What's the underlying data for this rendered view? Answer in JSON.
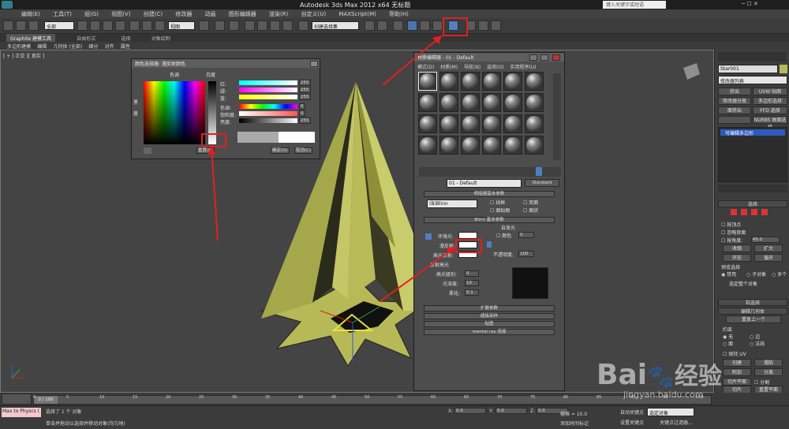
{
  "window": {
    "title": "Autodesk 3ds Max  2012 x64    无标题",
    "search_placeholder": "键入关键字或短语"
  },
  "menu": [
    "编辑(E)",
    "工具(T)",
    "组(G)",
    "视图(V)",
    "创建(C)",
    "修改器",
    "动画",
    "图形编辑器",
    "渲染(R)",
    "自定义(U)",
    "MAXScript(M)",
    "帮助(H)"
  ],
  "toolbar": {
    "filter": "全部",
    "view": "视图",
    "selection_set": "创建选择集"
  },
  "ribbon": {
    "tabs": [
      "Graphite 建模工具",
      "自由形式",
      "选择",
      "对象绘制"
    ],
    "subtabs": [
      "多边形建模",
      "编辑",
      "几何体 (全部)",
      "细分",
      "对齐",
      "属性"
    ]
  },
  "viewport": {
    "label": "[ + ] 正交 ][ 真实 ]"
  },
  "color_selector": {
    "title": "颜色选择器: 漫反射颜色",
    "hue_label": "色调",
    "whiteness_label": "白度",
    "blackness_label": "黑",
    "saturation_label": "度",
    "rows": [
      {
        "label": "红:",
        "value": "255"
      },
      {
        "label": "绿:",
        "value": "255"
      },
      {
        "label": "蓝:",
        "value": "255"
      },
      {
        "label": "色调:",
        "value": "0"
      },
      {
        "label": "饱和度:",
        "value": "0"
      },
      {
        "label": "亮度:",
        "value": "255"
      }
    ],
    "reset": "重置(R)",
    "ok": "确定(O)",
    "cancel": "取消(C)"
  },
  "material_editor": {
    "title": "材质编辑器 - 01 - Default",
    "menu": [
      "模式(D)",
      "材质(M)",
      "导航(N)",
      "选项(O)",
      "实用程序(U)"
    ],
    "material_name": "01 - Default",
    "material_type": "Standard",
    "shader_section": "明暗器基本参数",
    "shader": "(B)Blinn",
    "shader_options": [
      "线框",
      "双面",
      "面贴图",
      "面状"
    ],
    "blinn_section": "Blinn 基本参数",
    "self_illum": "自发光",
    "color_label": "颜色",
    "self_illum_value": "0",
    "ambient": "环境光:",
    "diffuse": "漫反射:",
    "specular": "高光反射:",
    "opacity_label": "不透明度:",
    "opacity": "100",
    "highlights": "反射高光",
    "spec_level_label": "高光级别:",
    "spec_level": "0",
    "gloss_label": "光泽度:",
    "gloss": "10",
    "soften_label": "柔化:",
    "soften": "0.1",
    "rollouts": [
      "扩展参数",
      "超级采样",
      "贴图",
      "mental ray 连接"
    ]
  },
  "command_panel": {
    "object_name": "Star001",
    "modifier_list": "修改器列表",
    "buttons": [
      "挤出",
      "UVW 贴图",
      "修改器分类",
      "多边形选择",
      "面挤出",
      "FFD 选择",
      "",
      "NURBS 曲面选择"
    ],
    "stack_item": "可编辑多边形",
    "selection": "选择",
    "by_vertex": "按顶点",
    "ignore_backface": "忽略背面",
    "angle_label": "按角度:",
    "angle": "45.0",
    "shrink": "收缩",
    "grow": "扩大",
    "ring": "环形",
    "loop": "循环",
    "preview": "预览选择",
    "disabled": "禁用",
    "subobject": "子对象",
    "multi": "多个",
    "select_all": "选定整个对象",
    "soft_selection": "软选择",
    "edit_geometry": "编辑几何体",
    "repeat": "重复上一个",
    "constraints": "约束",
    "none": "无",
    "edge": "边",
    "face": "面",
    "normal": "法线",
    "preserve_uv": "保持 UV",
    "create": "创建",
    "collapse": "塌陷",
    "attach": "附加",
    "detach": "分离",
    "slice_plane": "切片平面",
    "split": "分割",
    "slice": "切片",
    "reset_plane": "重置平面"
  },
  "timeline": {
    "frame": "0 / 100",
    "ticks": [
      "0",
      "5",
      "10",
      "15",
      "20",
      "25",
      "30",
      "35",
      "40",
      "45",
      "50",
      "55",
      "60",
      "65",
      "70",
      "75",
      "80",
      "85",
      "90",
      "95",
      "100"
    ]
  },
  "status": {
    "script": "Max to Physcs (",
    "selected": "选择了 1 个 对象",
    "hint": "单击并拖动以选择并移动对象(均匀地)",
    "x_label": "X:",
    "y_label": "Y:",
    "z_label": "Z:",
    "x": "0.0",
    "y": "0.0",
    "z": "0.0",
    "grid": "栅格 = 10.0",
    "autokey": "自动关键点",
    "setkey": "设置关键点",
    "selected_obj": "选定对象",
    "keyfilter": "关键点过滤器...",
    "addtime": "添加时间标记"
  },
  "watermark": {
    "brand": "Bai",
    "brand2": "经验",
    "url": "jingyan.baidu.com"
  },
  "colors": {
    "accent": "#e02020",
    "object": "#b7b957",
    "background": "#444444"
  }
}
